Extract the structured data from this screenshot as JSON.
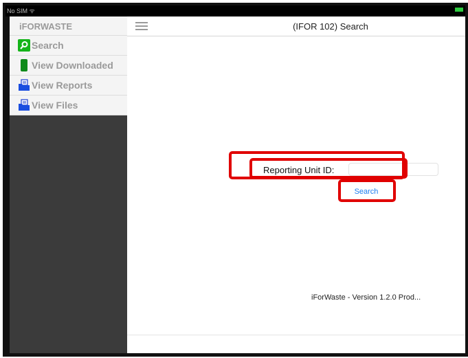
{
  "status_bar": {
    "carrier": "No SIM ᯤ",
    "time": ""
  },
  "sidebar": {
    "app_name": "iFORWASTE",
    "items": [
      {
        "label": "Search",
        "icon": "search-icon"
      },
      {
        "label": "View Downloaded",
        "icon": "download-icon"
      },
      {
        "label": "View Reports",
        "icon": "folder-icon"
      },
      {
        "label": "View Files",
        "icon": "folder-icon"
      }
    ]
  },
  "header": {
    "title": "(IFOR 102) Search"
  },
  "form": {
    "reporting_unit_label": "Reporting Unit ID:",
    "reporting_unit_value": "",
    "search_button": "Search"
  },
  "footer": {
    "version": "iForWaste - Version 1.2.0 Prod..."
  },
  "colors": {
    "highlight": "#e00000",
    "link": "#1a7cf0",
    "sidebar_bg": "#3b3b3b"
  }
}
